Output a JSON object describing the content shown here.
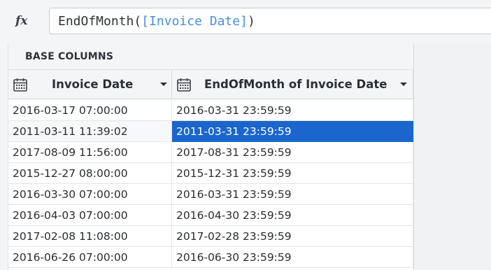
{
  "formula": {
    "fx_label": "fx",
    "func_prefix": "EndOfMonth(",
    "ref": "[Invoice Date]",
    "func_suffix": ")"
  },
  "group_header": "BASE COLUMNS",
  "columns": [
    {
      "label": "Invoice Date",
      "icon": "calendar-icon",
      "menu_icon": "caret-down-icon"
    },
    {
      "label": "EndOfMonth of Invoice Date",
      "icon": "calendar-icon",
      "menu_icon": "caret-down-icon"
    }
  ],
  "rows": [
    [
      "2016-03-17 07:00:00",
      "2016-03-31 23:59:59"
    ],
    [
      "2011-03-11 11:39:02",
      "2011-03-31 23:59:59"
    ],
    [
      "2017-08-09 11:56:00",
      "2017-08-31 23:59:59"
    ],
    [
      "2015-12-27 08:00:00",
      "2015-12-31 23:59:59"
    ],
    [
      "2016-03-30 07:00:00",
      "2016-03-31 23:59:59"
    ],
    [
      "2016-04-03 07:00:00",
      "2016-04-30 23:59:59"
    ],
    [
      "2017-02-08 11:08:00",
      "2017-02-28 23:59:59"
    ],
    [
      "2016-06-26 07:00:00",
      "2016-06-30 23:59:59"
    ]
  ],
  "selected_cell": {
    "row": 1,
    "col": 1
  },
  "colors": {
    "selection": "#1a66cc",
    "formula_ref": "#4a90d9"
  }
}
